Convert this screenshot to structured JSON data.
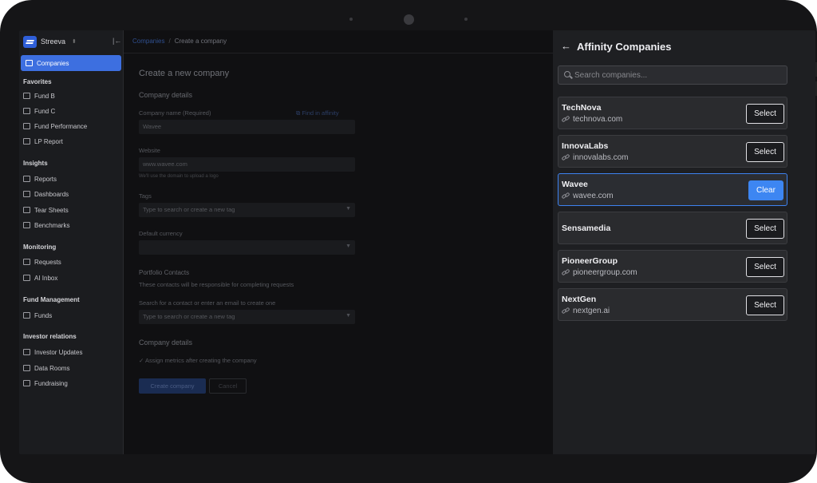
{
  "sidebar": {
    "brand": "Streeva",
    "active_item": "Companies",
    "groups": [
      {
        "title": "Favorites",
        "items": [
          "Fund B",
          "Fund C",
          "Fund Performance",
          "LP Report"
        ]
      },
      {
        "title": "Insights",
        "items": [
          "Reports",
          "Dashboards",
          "Tear Sheets",
          "Benchmarks"
        ]
      },
      {
        "title": "Monitoring",
        "items": [
          "Requests",
          "AI Inbox"
        ]
      },
      {
        "title": "Fund Management",
        "items": [
          "Funds"
        ]
      },
      {
        "title": "Investor relations",
        "items": [
          "Investor Updates",
          "Data Rooms",
          "Fundraising"
        ]
      }
    ]
  },
  "breadcrumb": {
    "parent": "Companies",
    "current": "Create a company"
  },
  "form": {
    "title": "Create a new company",
    "section_details": "Company details",
    "name_label": "Company name (Required)",
    "find_link": "Find in affinity",
    "name_value": "Wavee",
    "website_label": "Website",
    "website_value": "www.wavee.com",
    "website_hint": "We'll use the domain to upload a logo",
    "tags_label": "Tags",
    "tags_placeholder": "Type to search or create a new tag",
    "currency_label": "Default currency",
    "contacts_title": "Portfolio Contacts",
    "contacts_desc": "These contacts will be responsible for completing requests",
    "contact_label": "Search for a contact or enter an email to create one",
    "contact_placeholder": "Type to search or create a new tag",
    "section_details_2": "Company details",
    "assign_metrics": "Assign metrics after creating the company",
    "create_button": "Create company",
    "cancel_button": "Cancel"
  },
  "panel": {
    "title": "Affinity Companies",
    "search_placeholder": "Search companies...",
    "companies": [
      {
        "name": "TechNova",
        "domain": "technova.com",
        "action": "Select"
      },
      {
        "name": "InnovaLabs",
        "domain": "innovalabs.com",
        "action": "Select"
      },
      {
        "name": "Wavee",
        "domain": "wavee.com",
        "action": "Clear"
      },
      {
        "name": "Sensamedia",
        "domain": "",
        "action": "Select"
      },
      {
        "name": "PioneerGroup",
        "domain": "pioneergroup.com",
        "action": "Select"
      },
      {
        "name": "NextGen",
        "domain": "nextgen.ai",
        "action": "Select"
      }
    ]
  },
  "colors": {
    "accent": "#3d86f2",
    "panel_bg": "#1e1f22",
    "sidebar_bg": "#1b1c1f"
  }
}
